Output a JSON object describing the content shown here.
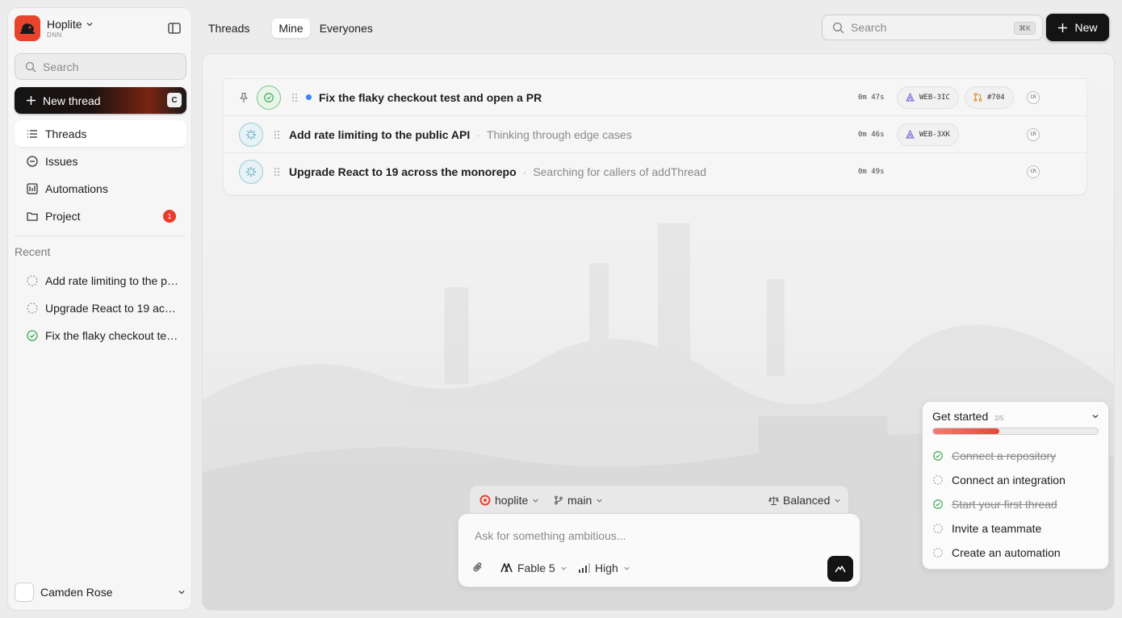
{
  "workspace": {
    "name": "Hoplite",
    "sub": "DNN"
  },
  "sidebar": {
    "search_placeholder": "Search",
    "new_thread_label": "New thread",
    "new_thread_shortcut": "C",
    "nav": [
      {
        "label": "Threads",
        "icon": "list-icon"
      },
      {
        "label": "Issues",
        "icon": "circle-minus-icon"
      },
      {
        "label": "Automations",
        "icon": "automation-icon"
      },
      {
        "label": "Project",
        "icon": "folder-icon",
        "badge": "1"
      }
    ],
    "recent_title": "Recent",
    "recent": [
      {
        "label": "Add rate limiting to the public API",
        "status": "pending"
      },
      {
        "label": "Upgrade React to 19 across the monorepo",
        "status": "pending"
      },
      {
        "label": "Fix the flaky checkout test and open a PR",
        "status": "done"
      }
    ],
    "user_name": "Camden Rose"
  },
  "topbar": {
    "tabs": [
      "Threads",
      "Mine",
      "Everyones"
    ],
    "selected_tab": "Mine",
    "search_placeholder": "Search",
    "search_shortcut": "⌘K",
    "new_label": "New"
  },
  "threads": [
    {
      "title": "Fix the flaky checkout test and open a PR",
      "sub": "",
      "time": "0m 47s",
      "chips": [
        "WEB-3IC",
        "#704"
      ],
      "status": "done",
      "cr": "CR"
    },
    {
      "title": "Add rate limiting to the public API",
      "sub": "Thinking through edge cases",
      "time": "0m 46s",
      "chips": [
        "WEB-3XK"
      ],
      "status": "running",
      "cr": "CR"
    },
    {
      "title": "Upgrade React to 19 across the monorepo",
      "sub": "Searching for callers of addThread",
      "time": "0m 49s",
      "chips": [],
      "status": "running",
      "cr": "CR"
    }
  ],
  "composer": {
    "repo": "hoplite",
    "branch": "main",
    "mode": "Balanced",
    "placeholder": "Ask for something ambitious...",
    "model": "Fable 5",
    "effort": "High"
  },
  "get_started": {
    "title": "Get started",
    "count": "2/5",
    "progress": 0.4,
    "items": [
      {
        "label": "Connect a repository",
        "done": true
      },
      {
        "label": "Connect an integration",
        "done": false
      },
      {
        "label": "Start your first thread",
        "done": true
      },
      {
        "label": "Invite a teammate",
        "done": false
      },
      {
        "label": "Create an automation",
        "done": false
      }
    ]
  },
  "colors": {
    "accent": "#e8432b",
    "badge": "#ec3a28",
    "done": "#3aa655",
    "unread": "#3b82f6"
  }
}
